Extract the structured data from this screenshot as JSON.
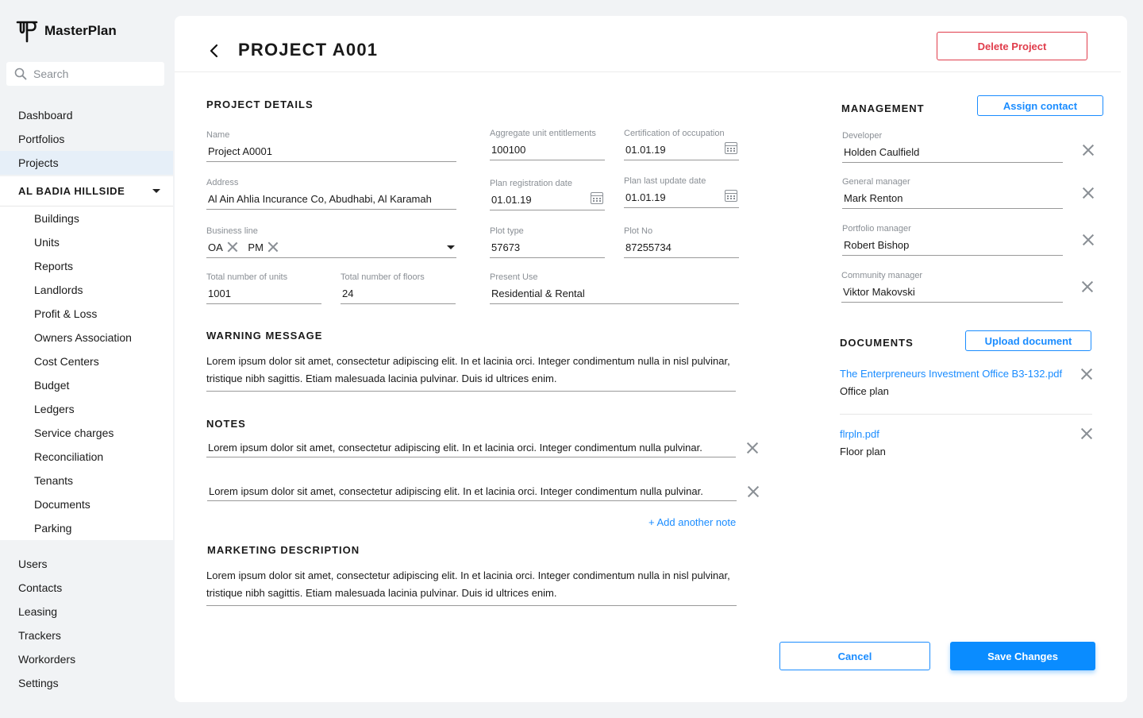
{
  "app": {
    "name": "MasterPlan"
  },
  "search": {
    "placeholder": "Search"
  },
  "nav_top": [
    {
      "label": "Dashboard"
    },
    {
      "label": "Portfolios"
    },
    {
      "label": "Projects"
    }
  ],
  "project_nav": {
    "title": "AL BADIA HILLSIDE",
    "items": [
      {
        "label": "Buildings"
      },
      {
        "label": "Units"
      },
      {
        "label": "Reports"
      },
      {
        "label": "Landlords"
      },
      {
        "label": "Profit & Loss"
      },
      {
        "label": "Owners Association"
      },
      {
        "label": "Cost Centers"
      },
      {
        "label": "Budget"
      },
      {
        "label": "Ledgers"
      },
      {
        "label": "Service charges"
      },
      {
        "label": "Reconciliation"
      },
      {
        "label": "Tenants"
      },
      {
        "label": "Documents"
      },
      {
        "label": "Parking"
      }
    ]
  },
  "nav_bottom": [
    {
      "label": "Users"
    },
    {
      "label": "Contacts"
    },
    {
      "label": "Leasing"
    },
    {
      "label": "Trackers"
    },
    {
      "label": "Workorders"
    },
    {
      "label": "Settings"
    }
  ],
  "header": {
    "title": "PROJECT A001",
    "delete_label": "Delete Project"
  },
  "details": {
    "section_title": "PROJECT DETAILS",
    "name": {
      "label": "Name",
      "value": "Project A0001"
    },
    "aggregate": {
      "label": "Aggregate unit entitlements",
      "value": "100100"
    },
    "certification": {
      "label": "Certification of occupation",
      "value": "01.01.19"
    },
    "address": {
      "label": "Address",
      "value": "Al Ain Ahlia Incurance Co, Abudhabi, Al Karamah"
    },
    "plan_registration": {
      "label": "Plan registration date",
      "value": "01.01.19"
    },
    "plan_update": {
      "label": "Plan last update date",
      "value": "01.01.19"
    },
    "business_line": {
      "label": "Business line",
      "chips": [
        "OA",
        "PM"
      ]
    },
    "plot_type": {
      "label": "Plot type",
      "value": "57673"
    },
    "plot_no": {
      "label": "Plot No",
      "value": "87255734"
    },
    "units": {
      "label": "Total number of units",
      "value": "1001"
    },
    "floors": {
      "label": "Total number of floors",
      "value": "24"
    },
    "present_use": {
      "label": "Present Use",
      "value": "Residential & Rental"
    }
  },
  "warning": {
    "title": "WARNING MESSAGE",
    "text": "Lorem ipsum dolor sit amet, consectetur adipiscing elit. In et lacinia orci. Integer condimentum nulla in nisl pulvinar, tristique nibh sagittis. Etiam malesuada lacinia pulvinar. Duis id ultrices enim."
  },
  "notes": {
    "title": "NOTES",
    "items": [
      {
        "text": "Lorem ipsum dolor sit amet, consectetur adipiscing elit. In et lacinia orci. Integer condimentum nulla pulvinar."
      },
      {
        "text": "Lorem ipsum dolor sit amet, consectetur adipiscing elit. In et lacinia orci. Integer condimentum nulla pulvinar."
      }
    ],
    "add_label": "+ Add another note"
  },
  "marketing": {
    "title": "MARKETING DESCRIPTION",
    "text": "Lorem ipsum dolor sit amet, consectetur adipiscing elit. In et lacinia orci. Integer condimentum nulla in nisl pulvinar, tristique nibh sagittis. Etiam malesuada lacinia pulvinar. Duis id ultrices enim."
  },
  "management": {
    "title": "MANAGEMENT",
    "assign_label": "Assign contact",
    "contacts": [
      {
        "role": "Developer",
        "name": "Holden Caulfield"
      },
      {
        "role": "General manager",
        "name": "Mark Renton"
      },
      {
        "role": "Portfolio manager",
        "name": "Robert Bishop"
      },
      {
        "role": "Community manager",
        "name": "Viktor Makovski"
      }
    ]
  },
  "documents": {
    "title": "DOCUMENTS",
    "upload_label": "Upload document",
    "items": [
      {
        "file": "The Enterpreneurs Investment Office  B3-132.pdf",
        "desc": "Office plan"
      },
      {
        "file": "flrpln.pdf",
        "desc": "Floor plan"
      }
    ]
  },
  "actions": {
    "cancel_label": "Cancel",
    "save_label": "Save Changes"
  },
  "colors": {
    "accent": "#0a8cff",
    "danger": "#e03c4b",
    "active_nav": "#e6eff8"
  }
}
